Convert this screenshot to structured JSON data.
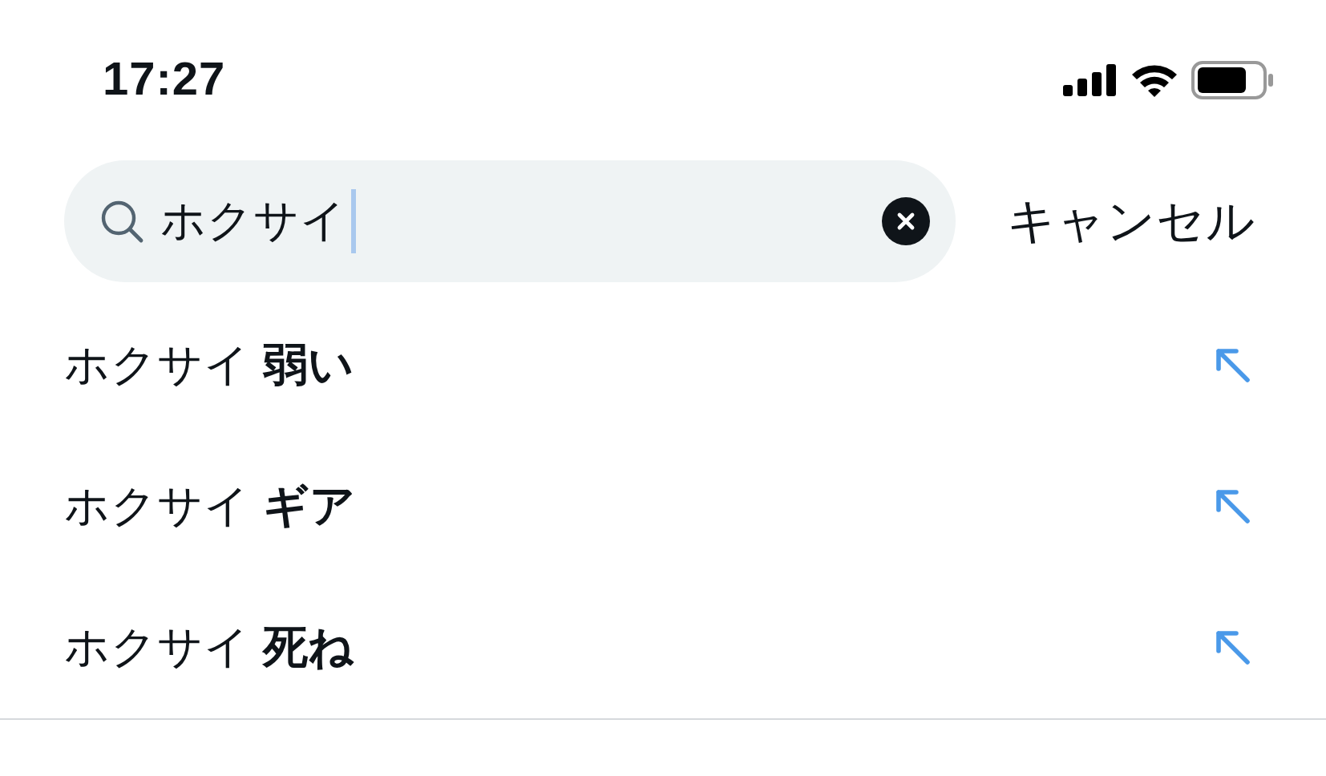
{
  "status_bar": {
    "time": "17:27"
  },
  "search": {
    "value": "ホクサイ",
    "cancel": "キャンセル"
  },
  "suggestions": [
    {
      "text": "ホクサイ **弱い**"
    },
    {
      "text": "ホクサイ **ギア**"
    },
    {
      "text": "ホクサイ **死ね**"
    }
  ]
}
